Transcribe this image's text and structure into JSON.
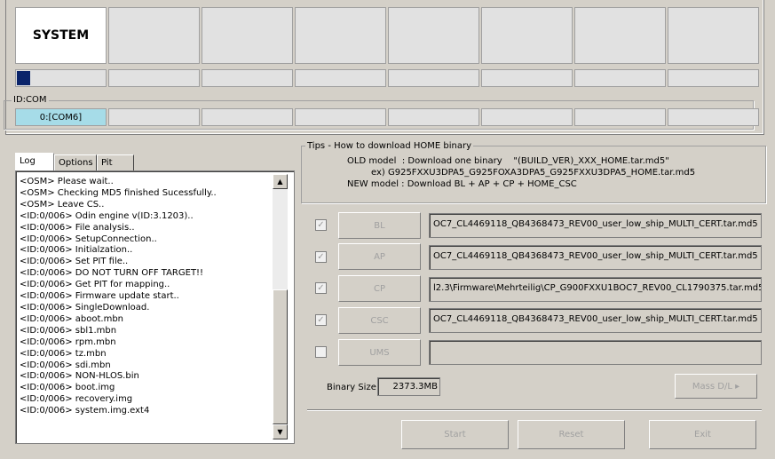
{
  "slots": {
    "active_label": "SYSTEM",
    "progress_fraction": 0.15
  },
  "idcom": {
    "label": "ID:COM",
    "active_port": "0:[COM6]"
  },
  "tabs": [
    "Log",
    "Options",
    "Pit"
  ],
  "log_lines": [
    "<OSM> Please wait..",
    "<OSM> Checking MD5 finished Sucessfully..",
    "<OSM> Leave CS..",
    "<ID:0/006> Odin engine v(ID:3.1203)..",
    "<ID:0/006> File analysis..",
    "<ID:0/006> SetupConnection..",
    "<ID:0/006> Initialzation..",
    "<ID:0/006> Set PIT file..",
    "<ID:0/006> DO NOT TURN OFF TARGET!!",
    "<ID:0/006> Get PIT for mapping..",
    "<ID:0/006> Firmware update start..",
    "<ID:0/006> SingleDownload.",
    "<ID:0/006> aboot.mbn",
    "<ID:0/006> sbl1.mbn",
    "<ID:0/006> rpm.mbn",
    "<ID:0/006> tz.mbn",
    "<ID:0/006> sdi.mbn",
    "<ID:0/006> NON-HLOS.bin",
    "<ID:0/006> boot.img",
    "<ID:0/006> recovery.img",
    "<ID:0/006> system.img.ext4"
  ],
  "tips": {
    "title": "Tips - How to download HOME binary",
    "line1": "OLD model  : Download one binary    \"(BUILD_VER)_XXX_HOME.tar.md5\"",
    "line2": "ex) G925FXXU3DPA5_G925FOXA3DPA5_G925FXXU3DPA5_HOME.tar.md5",
    "line3": "NEW model : Download BL + AP + CP + HOME_CSC"
  },
  "files": [
    {
      "label": "BL",
      "checked": "✓",
      "path": "OC7_CL4469118_QB4368473_REV00_user_low_ship_MULTI_CERT.tar.md5"
    },
    {
      "label": "AP",
      "checked": "✓",
      "path": "OC7_CL4469118_QB4368473_REV00_user_low_ship_MULTI_CERT.tar.md5"
    },
    {
      "label": "CP",
      "checked": "✓",
      "path": "l2.3\\Firmware\\Mehrteilig\\CP_G900FXXU1BOC7_REV00_CL1790375.tar.md5"
    },
    {
      "label": "CSC",
      "checked": "✓",
      "path": "OC7_CL4469118_QB4368473_REV00_user_low_ship_MULTI_CERT.tar.md5"
    },
    {
      "label": "UMS",
      "checked": "",
      "path": ""
    }
  ],
  "binary_size": {
    "label": "Binary Size",
    "value": "2373.3MB"
  },
  "buttons": {
    "mass_dl": "Mass D/L ▸",
    "start": "Start",
    "reset": "Reset",
    "exit": "Exit"
  },
  "colors": {
    "progress": "#0a246a",
    "active_com": "#a6dce8"
  }
}
